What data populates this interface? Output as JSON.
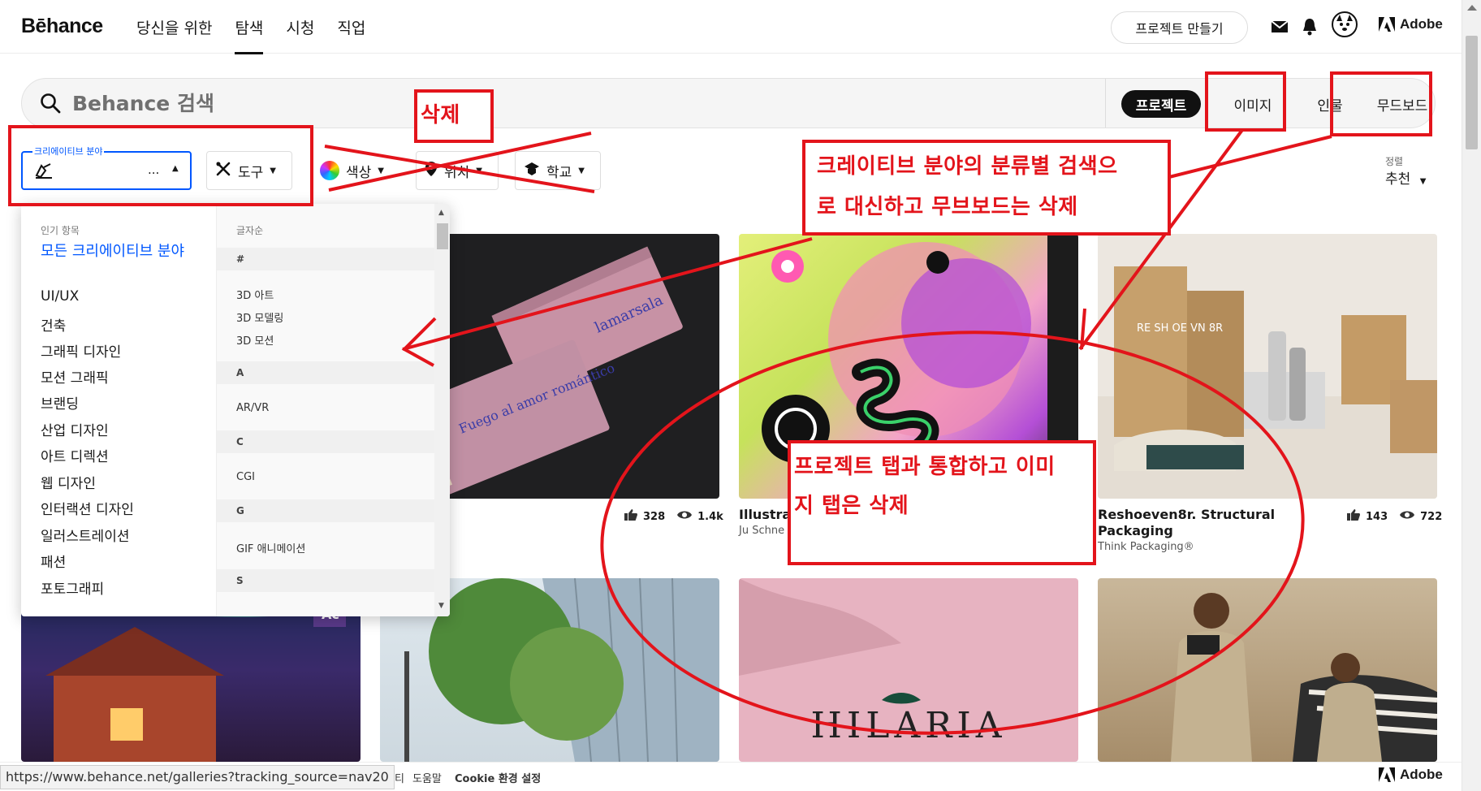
{
  "app": {
    "logo": "Bēhance"
  },
  "nav": {
    "links": [
      "당신을 위한",
      "탐색",
      "시청",
      "직업"
    ],
    "create_project": "프로젝트 만들기",
    "adobe_label": "Adobe"
  },
  "search": {
    "placeholder": "Behance 검색",
    "tabs": [
      "프로젝트",
      "이미지",
      "인물",
      "무드보드"
    ]
  },
  "filters": {
    "category_legend": "크리에이티브 분야",
    "category_value": "...",
    "tools": "도구",
    "color": "색상",
    "location": "위치",
    "school": "학교",
    "sort_label": "정렬",
    "sort_value": "추천"
  },
  "dropdown": {
    "popular_heading": "인기 항목",
    "popular_items": [
      "모든 크리에이티브 분야",
      "UI/UX",
      "건축",
      "그래픽 디자인",
      "모션 그래픽",
      "브랜딩",
      "산업 디자인",
      "아트 디렉션",
      "웹 디자인",
      "인터랙션 디자인",
      "일러스트레이션",
      "패션",
      "포토그래피"
    ],
    "alpha_heading": "글자순",
    "alpha_groups": [
      {
        "letter": "#",
        "items": [
          "3D 아트",
          "3D 모델링",
          "3D 모션"
        ]
      },
      {
        "letter": "A",
        "items": [
          "AR/VR"
        ]
      },
      {
        "letter": "C",
        "items": [
          "CGI"
        ]
      },
      {
        "letter": "G",
        "items": [
          "GIF 애니메이션"
        ]
      },
      {
        "letter": "S",
        "items": []
      }
    ]
  },
  "cards": [
    {
      "title": "",
      "owner": "",
      "likes": "328",
      "views": "1.4k"
    },
    {
      "title": "Illustra",
      "owner": "Ju Schne",
      "likes": "",
      "views": ""
    },
    {
      "title": "Reshoeven8r. Structural Packaging",
      "owner": "Think Packaging®",
      "likes": "143",
      "views": "722"
    }
  ],
  "card_art": {
    "matchbox_front": "Fuego al amor romántico",
    "matchbox_brand": "lamarsala",
    "box_mark": "RE SH OE VN 8R",
    "pink_brand": "HILARIA",
    "badge_ac": "Ac"
  },
  "footer": {
    "url": "https://www.behance.net/galleries?tracking_source=nav20",
    "links": [
      "티",
      "도움말",
      "Cookie 환경 설정"
    ],
    "adobe_label": "Adobe"
  },
  "annotations": {
    "delete_label": "삭제",
    "category_note": "크레이티브 분야의 분류별 검색으로 대신하고 무브보드는 삭제",
    "category_note_lines": [
      "크레이티브 분야의 분류별 검색으",
      "로 대신하고 무브보드는 삭제"
    ],
    "project_note_lines": [
      "프로젝트 탭과 통합하고 이미",
      "지 탭은 삭제"
    ],
    "color": "#e3141b"
  },
  "theme": {
    "accent_blue": "#0057ff",
    "dark": "#111111"
  }
}
